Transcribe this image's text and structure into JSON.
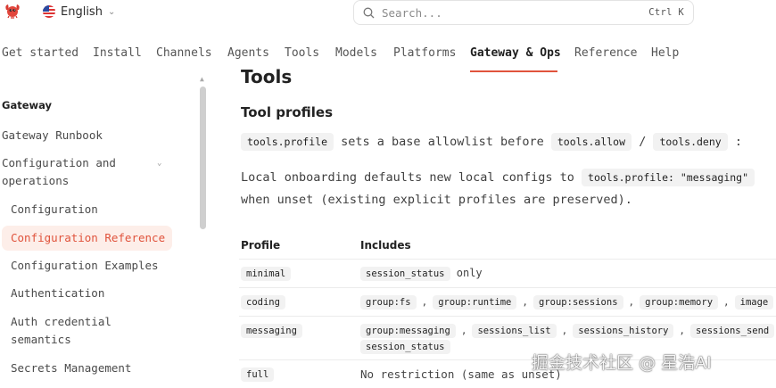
{
  "header": {
    "language": "English",
    "search_placeholder": "Search...",
    "search_shortcut": "Ctrl K"
  },
  "nav": {
    "tabs": [
      "Get started",
      "Install",
      "Channels",
      "Agents",
      "Tools",
      "Models",
      "Platforms",
      "Gateway & Ops",
      "Reference",
      "Help"
    ],
    "active": "Gateway & Ops"
  },
  "sidebar": {
    "group": "Gateway",
    "items": [
      {
        "label": "Gateway Runbook"
      },
      {
        "label": "Configuration and operations"
      },
      {
        "label": "Configuration"
      },
      {
        "label": "Configuration Reference"
      },
      {
        "label": "Configuration Examples"
      },
      {
        "label": "Authentication"
      },
      {
        "label": "Auth credential semantics"
      },
      {
        "label": "Secrets Management"
      }
    ]
  },
  "content": {
    "title": "Tools",
    "section": "Tool profiles",
    "p1": {
      "code1": "tools.profile",
      "text1": "sets a base allowlist before",
      "code2": "tools.allow",
      "slash": "/",
      "code3": "tools.deny",
      "colon": ":"
    },
    "p2": {
      "text1": "Local onboarding defaults new local configs to",
      "code1": "tools.profile: \"messaging\"",
      "text2": "when unset (existing explicit profiles are preserved)."
    },
    "table": {
      "headers": [
        "Profile",
        "Includes"
      ],
      "rows": [
        {
          "profile": "minimal",
          "includes": [
            "session_status"
          ],
          "suffix": "only"
        },
        {
          "profile": "coding",
          "includes": [
            "group:fs",
            "group:runtime",
            "group:sessions",
            "group:memory",
            "image"
          ]
        },
        {
          "profile": "messaging",
          "includes": [
            "group:messaging",
            "sessions_list",
            "sessions_history",
            "sessions_send",
            "session_status"
          ]
        },
        {
          "profile": "full",
          "text": "No restriction (same as unset)"
        }
      ]
    }
  },
  "watermark": "掘金技术社区 @ 星浩AI",
  "colors": {
    "accent": "#e0533c",
    "code_bg": "#f2f2f2"
  }
}
